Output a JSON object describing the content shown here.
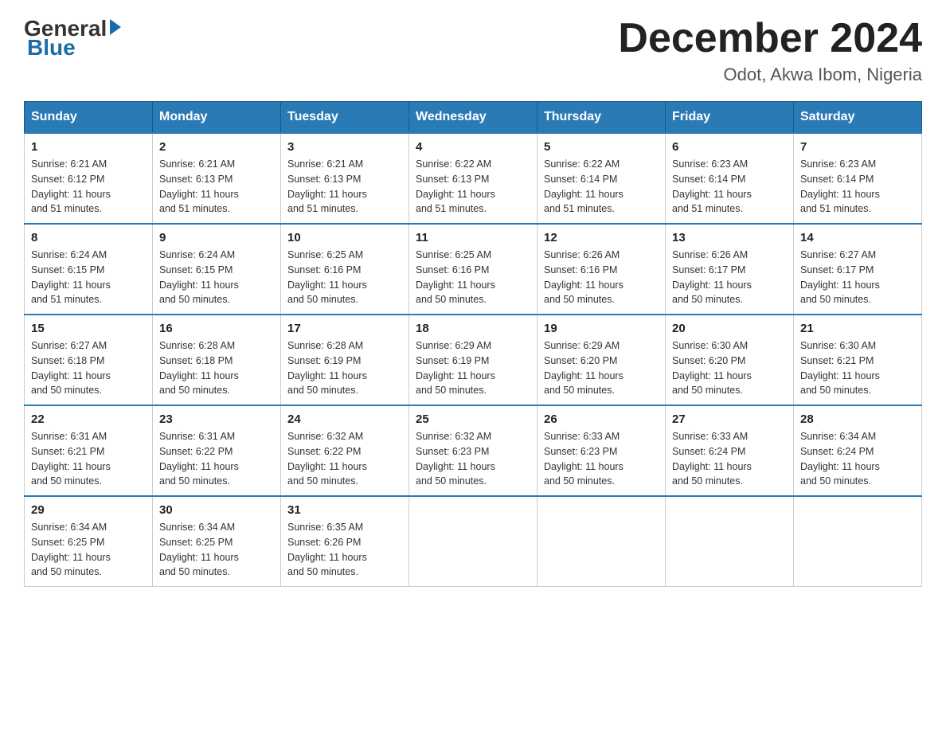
{
  "header": {
    "logo_general": "General",
    "logo_blue": "Blue",
    "month_title": "December 2024",
    "location": "Odot, Akwa Ibom, Nigeria"
  },
  "days_of_week": [
    "Sunday",
    "Monday",
    "Tuesday",
    "Wednesday",
    "Thursday",
    "Friday",
    "Saturday"
  ],
  "weeks": [
    [
      {
        "day": "1",
        "sunrise": "6:21 AM",
        "sunset": "6:12 PM",
        "daylight": "11 hours and 51 minutes."
      },
      {
        "day": "2",
        "sunrise": "6:21 AM",
        "sunset": "6:13 PM",
        "daylight": "11 hours and 51 minutes."
      },
      {
        "day": "3",
        "sunrise": "6:21 AM",
        "sunset": "6:13 PM",
        "daylight": "11 hours and 51 minutes."
      },
      {
        "day": "4",
        "sunrise": "6:22 AM",
        "sunset": "6:13 PM",
        "daylight": "11 hours and 51 minutes."
      },
      {
        "day": "5",
        "sunrise": "6:22 AM",
        "sunset": "6:14 PM",
        "daylight": "11 hours and 51 minutes."
      },
      {
        "day": "6",
        "sunrise": "6:23 AM",
        "sunset": "6:14 PM",
        "daylight": "11 hours and 51 minutes."
      },
      {
        "day": "7",
        "sunrise": "6:23 AM",
        "sunset": "6:14 PM",
        "daylight": "11 hours and 51 minutes."
      }
    ],
    [
      {
        "day": "8",
        "sunrise": "6:24 AM",
        "sunset": "6:15 PM",
        "daylight": "11 hours and 51 minutes."
      },
      {
        "day": "9",
        "sunrise": "6:24 AM",
        "sunset": "6:15 PM",
        "daylight": "11 hours and 50 minutes."
      },
      {
        "day": "10",
        "sunrise": "6:25 AM",
        "sunset": "6:16 PM",
        "daylight": "11 hours and 50 minutes."
      },
      {
        "day": "11",
        "sunrise": "6:25 AM",
        "sunset": "6:16 PM",
        "daylight": "11 hours and 50 minutes."
      },
      {
        "day": "12",
        "sunrise": "6:26 AM",
        "sunset": "6:16 PM",
        "daylight": "11 hours and 50 minutes."
      },
      {
        "day": "13",
        "sunrise": "6:26 AM",
        "sunset": "6:17 PM",
        "daylight": "11 hours and 50 minutes."
      },
      {
        "day": "14",
        "sunrise": "6:27 AM",
        "sunset": "6:17 PM",
        "daylight": "11 hours and 50 minutes."
      }
    ],
    [
      {
        "day": "15",
        "sunrise": "6:27 AM",
        "sunset": "6:18 PM",
        "daylight": "11 hours and 50 minutes."
      },
      {
        "day": "16",
        "sunrise": "6:28 AM",
        "sunset": "6:18 PM",
        "daylight": "11 hours and 50 minutes."
      },
      {
        "day": "17",
        "sunrise": "6:28 AM",
        "sunset": "6:19 PM",
        "daylight": "11 hours and 50 minutes."
      },
      {
        "day": "18",
        "sunrise": "6:29 AM",
        "sunset": "6:19 PM",
        "daylight": "11 hours and 50 minutes."
      },
      {
        "day": "19",
        "sunrise": "6:29 AM",
        "sunset": "6:20 PM",
        "daylight": "11 hours and 50 minutes."
      },
      {
        "day": "20",
        "sunrise": "6:30 AM",
        "sunset": "6:20 PM",
        "daylight": "11 hours and 50 minutes."
      },
      {
        "day": "21",
        "sunrise": "6:30 AM",
        "sunset": "6:21 PM",
        "daylight": "11 hours and 50 minutes."
      }
    ],
    [
      {
        "day": "22",
        "sunrise": "6:31 AM",
        "sunset": "6:21 PM",
        "daylight": "11 hours and 50 minutes."
      },
      {
        "day": "23",
        "sunrise": "6:31 AM",
        "sunset": "6:22 PM",
        "daylight": "11 hours and 50 minutes."
      },
      {
        "day": "24",
        "sunrise": "6:32 AM",
        "sunset": "6:22 PM",
        "daylight": "11 hours and 50 minutes."
      },
      {
        "day": "25",
        "sunrise": "6:32 AM",
        "sunset": "6:23 PM",
        "daylight": "11 hours and 50 minutes."
      },
      {
        "day": "26",
        "sunrise": "6:33 AM",
        "sunset": "6:23 PM",
        "daylight": "11 hours and 50 minutes."
      },
      {
        "day": "27",
        "sunrise": "6:33 AM",
        "sunset": "6:24 PM",
        "daylight": "11 hours and 50 minutes."
      },
      {
        "day": "28",
        "sunrise": "6:34 AM",
        "sunset": "6:24 PM",
        "daylight": "11 hours and 50 minutes."
      }
    ],
    [
      {
        "day": "29",
        "sunrise": "6:34 AM",
        "sunset": "6:25 PM",
        "daylight": "11 hours and 50 minutes."
      },
      {
        "day": "30",
        "sunrise": "6:34 AM",
        "sunset": "6:25 PM",
        "daylight": "11 hours and 50 minutes."
      },
      {
        "day": "31",
        "sunrise": "6:35 AM",
        "sunset": "6:26 PM",
        "daylight": "11 hours and 50 minutes."
      },
      null,
      null,
      null,
      null
    ]
  ],
  "labels": {
    "sunrise": "Sunrise:",
    "sunset": "Sunset:",
    "daylight": "Daylight:"
  }
}
